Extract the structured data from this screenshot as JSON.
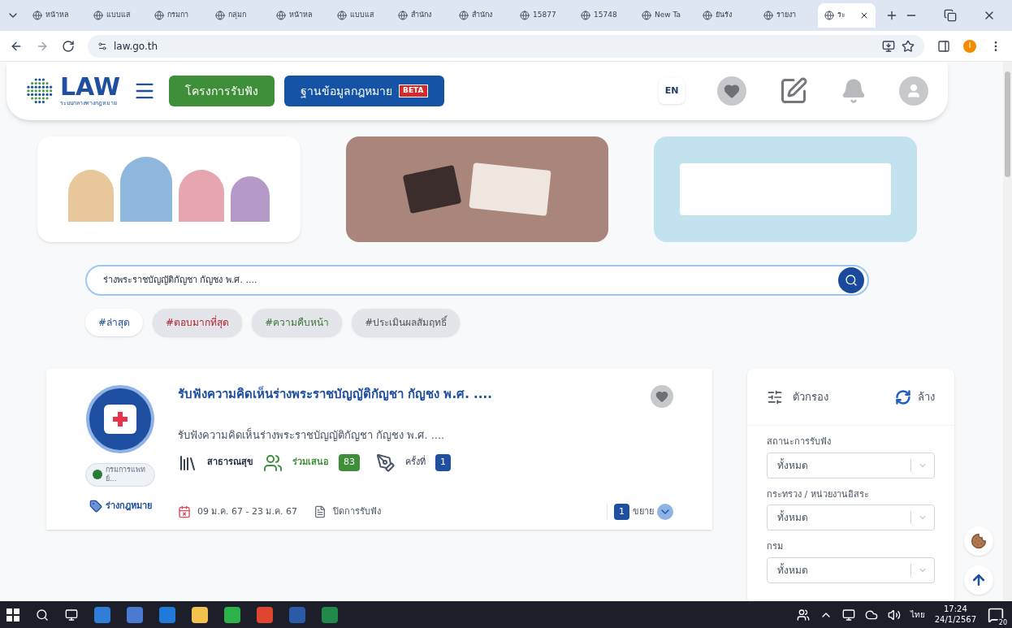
{
  "browser": {
    "tabs": [
      {
        "title": "หน้าหล",
        "selected": false
      },
      {
        "title": "แบบแส",
        "selected": false
      },
      {
        "title": "กรมกา",
        "selected": false
      },
      {
        "title": "กลุ่มก",
        "selected": false
      },
      {
        "title": "หน้าหล",
        "selected": false
      },
      {
        "title": "แบบแส",
        "selected": false
      },
      {
        "title": "สำนักง",
        "selected": false
      },
      {
        "title": "สำนักง",
        "selected": false
      },
      {
        "title": "15877",
        "selected": false
      },
      {
        "title": "15748",
        "selected": false
      },
      {
        "title": "New Ta",
        "selected": false
      },
      {
        "title": "ยันรัง",
        "selected": false
      },
      {
        "title": "รายงา",
        "selected": false
      },
      {
        "title": "ระ",
        "selected": true
      }
    ],
    "address": "law.go.th",
    "profile_initial": "I"
  },
  "header": {
    "logo": "LAW",
    "logo_subtitle": "ระบบกลางทางกฎหมาย",
    "nav": [
      {
        "label": "โครงการรับฟัง",
        "kind": "green"
      },
      {
        "label": "ฐานข้อมูลกฎหมาย",
        "kind": "blue",
        "badge": "BETA"
      }
    ],
    "language": "EN"
  },
  "search": {
    "value": "ร่างพระราชบัญญัติกัญชา กัญชง พ.ศ. ....",
    "hashtags": [
      {
        "label": "#ล่าสุด",
        "selected": true,
        "color": "#1e4e9c"
      },
      {
        "label": "#ตอบมากที่สุด",
        "selected": false,
        "color": "#b3262e"
      },
      {
        "label": "#ความคืบหน้า",
        "selected": false,
        "color": "#3d7a3a"
      },
      {
        "label": "#ประเมินผลสัมฤทธิ์",
        "selected": false,
        "color": "#555555"
      }
    ]
  },
  "card": {
    "title": "รับฟังความคิดเห็นร่างพระราชบัญญัติกัญชา กัญชง พ.ศ. ....",
    "description": "รับฟังความคิดเห็นร่างพระราชบัญญัติกัญชา กัญชง พ.ศ. ....",
    "agency": "กรมการแพทย์...",
    "category": "สาธารณสุข",
    "participate_label": "ร่วมเสนอ",
    "participate_count": "83",
    "round_label": "ครั้งที่",
    "round": "1",
    "tag": "ร่างกฎหมาย",
    "dates": "09 ม.ค. 67 - 23 ม.ค. 67",
    "status": "ปิดการรับฟัง",
    "expand_count": "1",
    "expand_label": "ขยาย"
  },
  "filter": {
    "title": "ตัวกรอง",
    "clear": "ล้าง",
    "fields": [
      {
        "label": "สถานะการรับฟัง",
        "value": "ทั้งหมด"
      },
      {
        "label": "กระทรวง / หน่วยงานอิสระ",
        "value": "ทั้งหมด"
      },
      {
        "label": "กรม",
        "value": "ทั้งหมด"
      }
    ]
  },
  "taskbar": {
    "language": "ไทย",
    "time": "17:24",
    "date": "24/1/2567",
    "notifications": "20"
  }
}
